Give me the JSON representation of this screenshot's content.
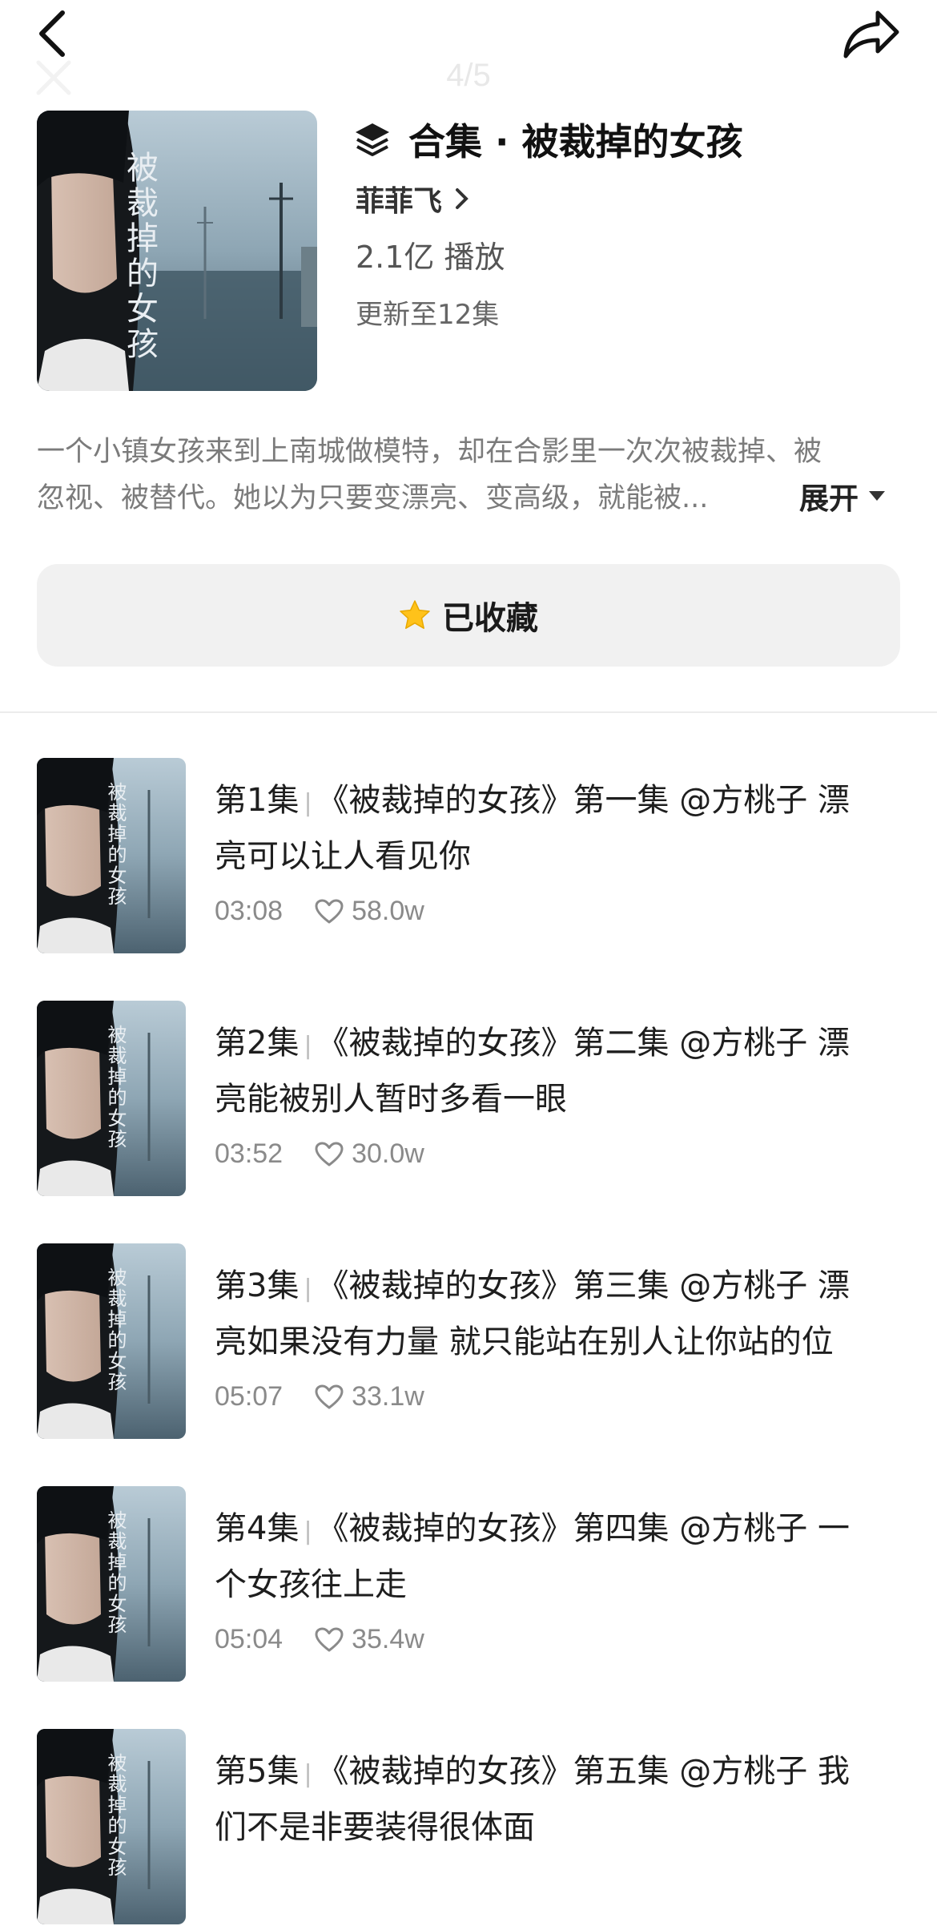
{
  "topbar": {
    "page_indicator": "4/5"
  },
  "cover": {
    "title_art": "被裁掉的女孩"
  },
  "collection": {
    "title": "合集 · 被裁掉的女孩",
    "author": "菲菲飞",
    "plays": "2.1亿 播放",
    "update": "更新至12集"
  },
  "description": {
    "line1": "一个小镇女孩来到上南城做模特，却在合影里一次次被裁掉、被",
    "line2": "忽视、被替代。她以为只要变漂亮、变高级，就能被...",
    "expand_label": "展开"
  },
  "collect_button": {
    "label": "已收藏"
  },
  "episodes": [
    {
      "num": "第1集",
      "line1": "《被裁掉的女孩》第一集 @方桃子 漂",
      "line2": "亮可以让人看见你",
      "duration": "03:08",
      "likes": "58.0w"
    },
    {
      "num": "第2集",
      "line1": "《被裁掉的女孩》第二集 @方桃子 漂",
      "line2": "亮能被别人暂时多看一眼",
      "duration": "03:52",
      "likes": "30.0w"
    },
    {
      "num": "第3集",
      "line1": "《被裁掉的女孩》第三集 @方桃子 漂",
      "line2": "亮如果没有力量  就只能站在别人让你站的位",
      "duration": "05:07",
      "likes": "33.1w"
    },
    {
      "num": "第4集",
      "line1": "《被裁掉的女孩》第四集 @方桃子 一",
      "line2": "个女孩往上走",
      "duration": "05:04",
      "likes": "35.4w"
    },
    {
      "num": "第5集",
      "line1": "《被裁掉的女孩》第五集 @方桃子  我",
      "line2": "们不是非要装得很体面",
      "duration": "",
      "likes": ""
    }
  ]
}
